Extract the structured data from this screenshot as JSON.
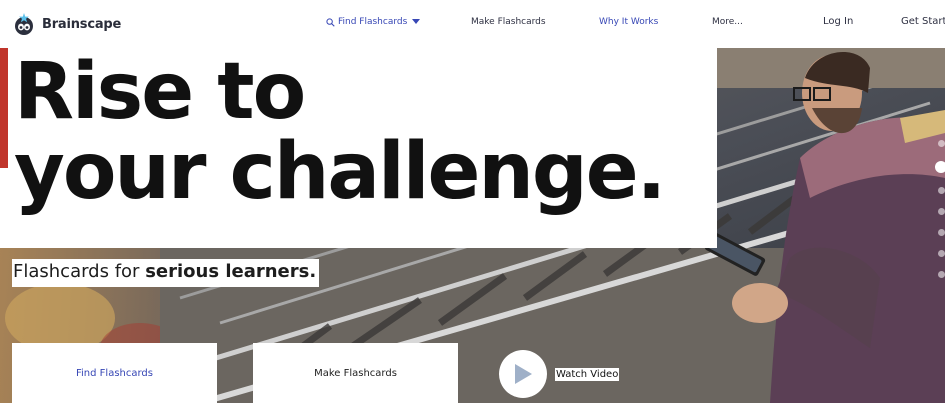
{
  "brand": {
    "name": "Brainscape",
    "logo_icon": "brain-mascot-icon",
    "accent_color": "#3747b5"
  },
  "nav": {
    "find_flashcards": "Find Flashcards",
    "make_flashcards": "Make Flashcards",
    "why_it_works": "Why It Works",
    "more": "More...",
    "log_in": "Log In",
    "get_started": "Get Starte"
  },
  "hero": {
    "headline_line1": "Rise to",
    "headline_line2": "your challenge.",
    "subheadline_plain": "Flashcards for ",
    "subheadline_bold": "serious learners."
  },
  "cta": {
    "find_flashcards": "Find Flashcards",
    "make_flashcards": "Make Flashcards",
    "watch_video": "Watch Video",
    "play_icon": "play-icon"
  },
  "slider": {
    "dot_count": 7,
    "active_index": 1
  }
}
